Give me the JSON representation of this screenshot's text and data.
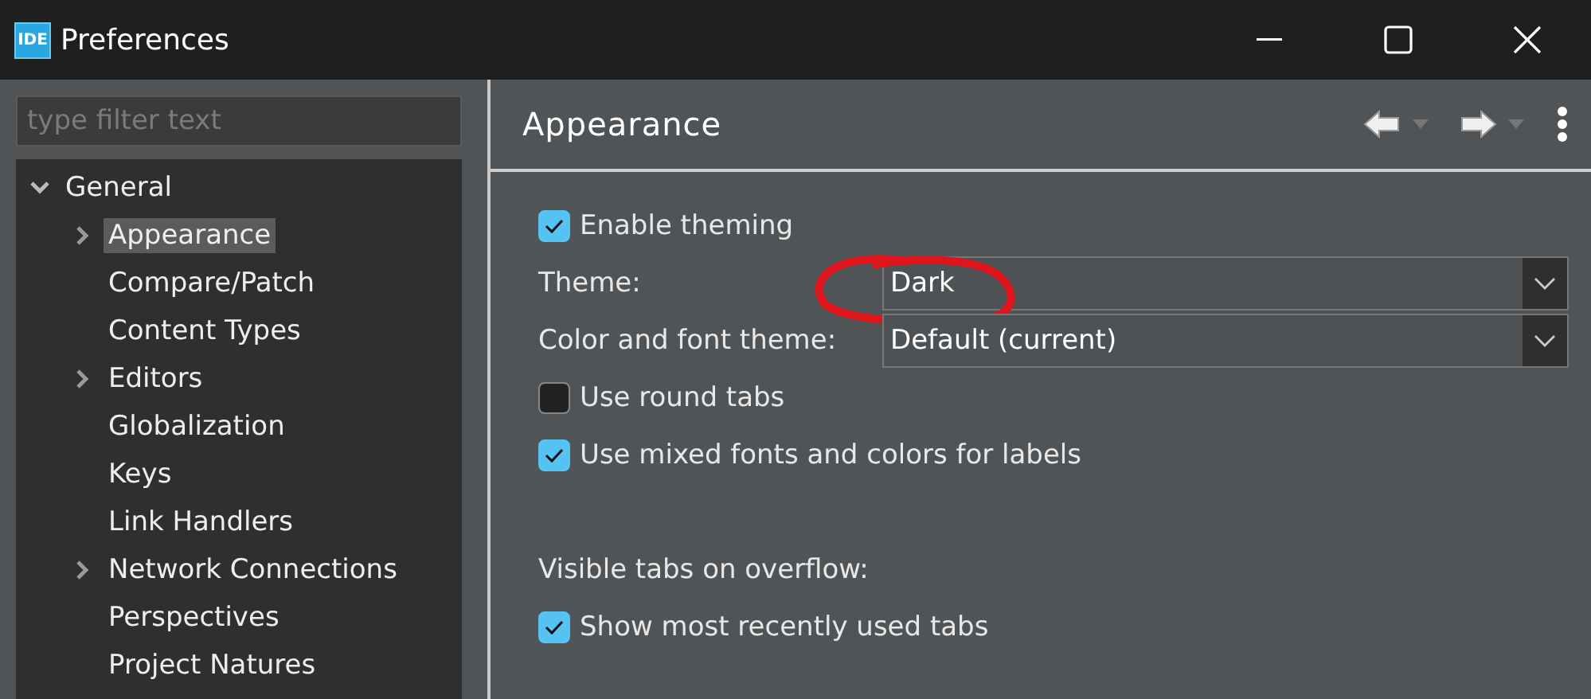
{
  "window": {
    "app_icon": "IDE",
    "title": "Preferences"
  },
  "filter": {
    "placeholder": "type filter text"
  },
  "tree": [
    {
      "label": "General",
      "expanded": true,
      "selected": false,
      "children": [
        {
          "label": "Appearance",
          "expandable": true,
          "selected": true
        },
        {
          "label": "Compare/Patch",
          "expandable": false,
          "selected": false
        },
        {
          "label": "Content Types",
          "expandable": false,
          "selected": false
        },
        {
          "label": "Editors",
          "expandable": true,
          "selected": false
        },
        {
          "label": "Globalization",
          "expandable": false,
          "selected": false
        },
        {
          "label": "Keys",
          "expandable": false,
          "selected": false
        },
        {
          "label": "Link Handlers",
          "expandable": false,
          "selected": false
        },
        {
          "label": "Network Connections",
          "expandable": true,
          "selected": false
        },
        {
          "label": "Perspectives",
          "expandable": false,
          "selected": false
        },
        {
          "label": "Project Natures",
          "expandable": false,
          "selected": false
        }
      ]
    }
  ],
  "page": {
    "title": "Appearance",
    "fields": [
      {
        "kind": "checkbox",
        "label": "Enable theming",
        "checked": true
      },
      {
        "kind": "combo",
        "label": "Theme:",
        "value": "Dark",
        "annotated": true
      },
      {
        "kind": "combo",
        "label": "Color and font theme:",
        "value": "Default (current)",
        "annotated": false
      },
      {
        "kind": "checkbox",
        "label": "Use round tabs",
        "checked": false
      },
      {
        "kind": "checkbox",
        "label": "Use mixed fonts and colors for labels",
        "checked": true
      },
      {
        "kind": "spacer"
      },
      {
        "kind": "label",
        "label": "Visible tabs on overflow:"
      },
      {
        "kind": "checkbox",
        "label": "Show most recently used tabs",
        "checked": true
      }
    ]
  }
}
